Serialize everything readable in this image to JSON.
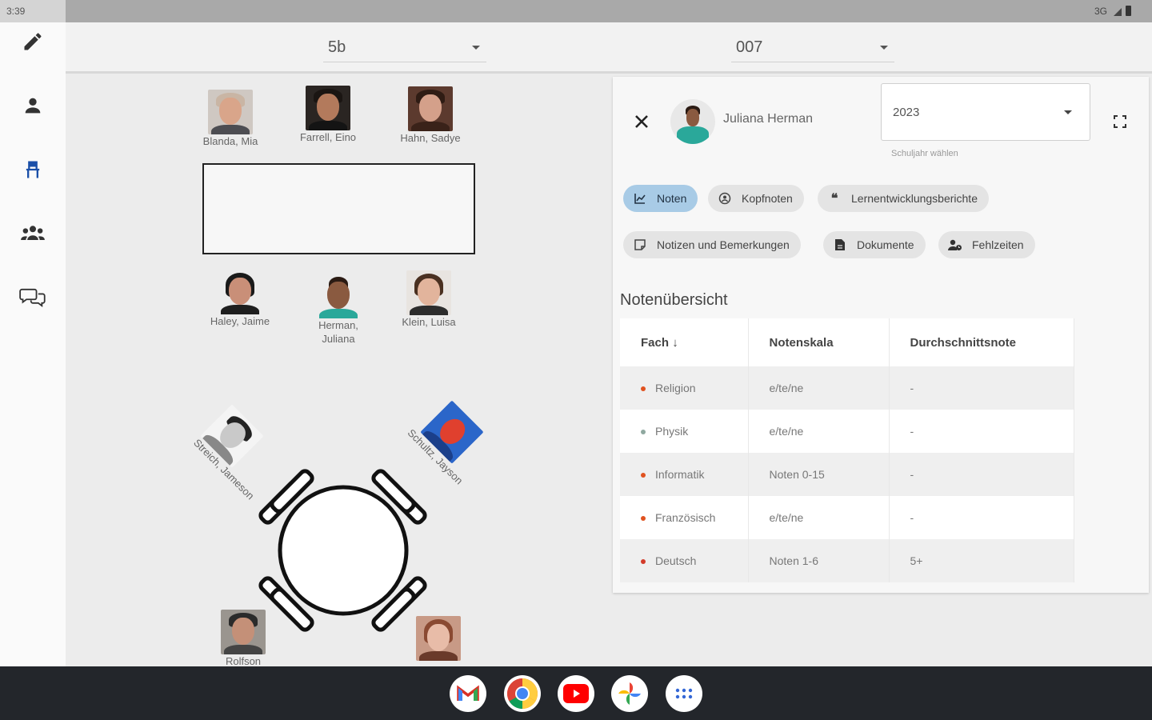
{
  "status": {
    "time": "3:39",
    "network": "3G"
  },
  "nav_rail": {
    "items": [
      {
        "name": "edit",
        "icon": "pencil-icon"
      },
      {
        "name": "student",
        "icon": "person-icon"
      },
      {
        "name": "seating",
        "icon": "chair-icon",
        "active": true
      },
      {
        "name": "groups",
        "icon": "group-icon"
      },
      {
        "name": "messages",
        "icon": "chat-icon"
      }
    ],
    "active_color": "#1a4fa8"
  },
  "top_bar": {
    "class_value": "5b",
    "room_value": "007"
  },
  "seating": {
    "top_row": [
      "Blanda, Mia",
      "Farrell, Eino",
      "Hahn, Sadye"
    ],
    "bottom_row": [
      "Haley, Jaime",
      "Herman, Juliana",
      "Klein, Luisa"
    ],
    "round_table": [
      "Streich, Jameson",
      "Schultz, Jayson",
      "Rolfson"
    ]
  },
  "panel": {
    "student_name": "Juliana Herman",
    "year_value": "2023",
    "year_hint": "Schuljahr wählen",
    "chips": [
      {
        "label": "Noten",
        "icon": "chart-icon",
        "active": true
      },
      {
        "label": "Kopfnoten",
        "icon": "face-icon"
      },
      {
        "label": "Lernentwicklungsberichte",
        "icon": "quote-icon"
      },
      {
        "label": "Notizen und Bemerkungen",
        "icon": "note-icon"
      },
      {
        "label": "Dokumente",
        "icon": "document-icon"
      },
      {
        "label": "Fehlzeiten",
        "icon": "person-clock-icon"
      }
    ],
    "section_title": "Notenübersicht",
    "table": {
      "headers": [
        "Fach",
        "Notenskala",
        "Durchschnittsnote"
      ],
      "rows": [
        {
          "subject": "Religion",
          "scale": "e/te/ne",
          "average": "-",
          "dot": "#e0521f"
        },
        {
          "subject": "Physik",
          "scale": "e/te/ne",
          "average": "-",
          "dot": "#8fa8a0"
        },
        {
          "subject": "Informatik",
          "scale": "Noten 0-15",
          "average": "-",
          "dot": "#e0521f"
        },
        {
          "subject": "Französisch",
          "scale": "e/te/ne",
          "average": "-",
          "dot": "#e0521f"
        },
        {
          "subject": "Deutsch",
          "scale": "Noten 1-6",
          "average": "5+",
          "dot": "#d33b2a"
        }
      ]
    }
  },
  "dock": {
    "apps": [
      "gmail-icon",
      "chrome-icon",
      "youtube-icon",
      "photos-icon",
      "app-launcher-icon"
    ]
  }
}
